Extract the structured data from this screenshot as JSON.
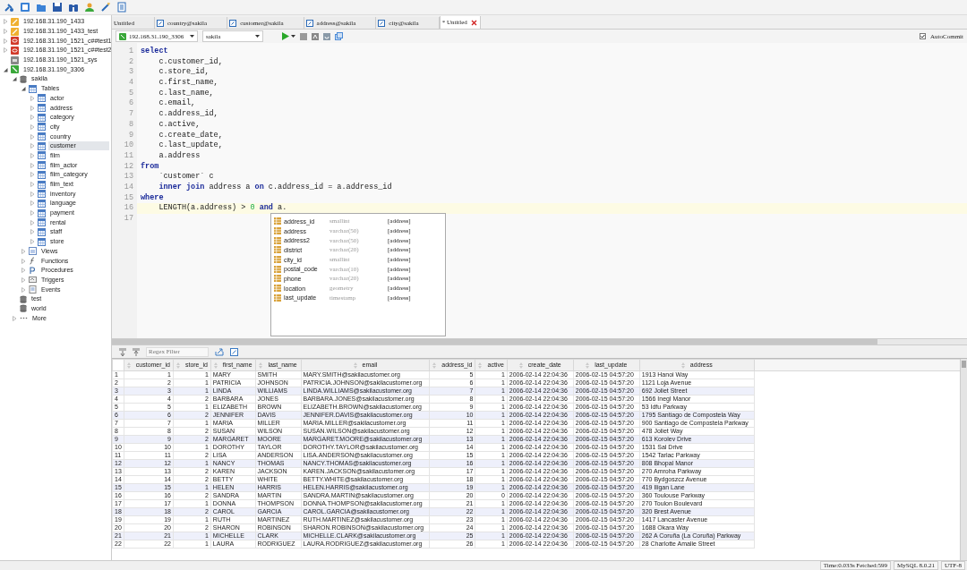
{
  "tree": [
    {
      "label": "192.168.31.190_1433",
      "kind": "mssql",
      "expanded": false,
      "selected": false
    },
    {
      "label": "192.168.31.190_1433_test",
      "kind": "mssql",
      "expanded": false,
      "selected": false
    },
    {
      "label": "192.168.31.190_1521_c##test1",
      "kind": "oracle",
      "expanded": false,
      "selected": false
    },
    {
      "label": "192.168.31.190_1521_c##test2",
      "kind": "oracle",
      "expanded": false,
      "selected": false
    },
    {
      "label": "192.168.31.190_1521_sys",
      "kind": "generic",
      "selected": false
    },
    {
      "label": "192.168.31.190_3306",
      "kind": "mysql",
      "expanded": true,
      "selected": false,
      "children": [
        {
          "label": "sakila",
          "kind": "database",
          "expanded": true,
          "selected": false,
          "children": [
            {
              "label": "Tables",
              "kind": "tables",
              "expanded": true,
              "selected": false,
              "children": [
                {
                  "label": "actor",
                  "kind": "table",
                  "expanded": false,
                  "selected": false
                },
                {
                  "label": "address",
                  "kind": "table",
                  "expanded": false,
                  "selected": false
                },
                {
                  "label": "category",
                  "kind": "table",
                  "expanded": false,
                  "selected": false
                },
                {
                  "label": "city",
                  "kind": "table",
                  "expanded": false,
                  "selected": false
                },
                {
                  "label": "country",
                  "kind": "table",
                  "expanded": false,
                  "selected": false
                },
                {
                  "label": "customer",
                  "kind": "table",
                  "expanded": false,
                  "selected": true
                },
                {
                  "label": "film",
                  "kind": "table",
                  "expanded": false,
                  "selected": false
                },
                {
                  "label": "film_actor",
                  "kind": "table",
                  "expanded": false,
                  "selected": false
                },
                {
                  "label": "film_category",
                  "kind": "table",
                  "expanded": false,
                  "selected": false
                },
                {
                  "label": "film_text",
                  "kind": "table",
                  "expanded": false,
                  "selected": false
                },
                {
                  "label": "inventory",
                  "kind": "table",
                  "expanded": false,
                  "selected": false
                },
                {
                  "label": "language",
                  "kind": "table",
                  "expanded": false,
                  "selected": false
                },
                {
                  "label": "payment",
                  "kind": "table",
                  "expanded": false,
                  "selected": false
                },
                {
                  "label": "rental",
                  "kind": "table",
                  "expanded": false,
                  "selected": false
                },
                {
                  "label": "staff",
                  "kind": "table",
                  "expanded": false,
                  "selected": false
                },
                {
                  "label": "store",
                  "kind": "table",
                  "expanded": false,
                  "selected": false
                }
              ]
            },
            {
              "label": "Views",
              "kind": "views",
              "expanded": false,
              "selected": false
            },
            {
              "label": "Functions",
              "kind": "functions",
              "expanded": false,
              "selected": false
            },
            {
              "label": "Procedures",
              "kind": "procedures",
              "expanded": false,
              "selected": false
            },
            {
              "label": "Triggers",
              "kind": "triggers",
              "expanded": false,
              "selected": false
            },
            {
              "label": "Events",
              "kind": "events",
              "expanded": false,
              "selected": false
            }
          ]
        },
        {
          "label": "test",
          "kind": "database",
          "selected": false
        },
        {
          "label": "world",
          "kind": "database",
          "selected": false
        },
        {
          "label": "More",
          "kind": "more",
          "expanded": false,
          "selected": false
        }
      ]
    }
  ],
  "tabs": [
    {
      "label": "Untitled",
      "kind": "query",
      "selected": false
    },
    {
      "label": "country@sakila",
      "kind": "table",
      "selected": false
    },
    {
      "label": "customer@sakila",
      "kind": "table",
      "selected": false
    },
    {
      "label": "address@sakila",
      "kind": "table",
      "selected": false
    },
    {
      "label": "city@sakila",
      "kind": "table",
      "selected": false
    },
    {
      "label": "* Untitled",
      "kind": "query",
      "selected": true
    }
  ],
  "query_toolbar": {
    "connection": "192.168.31.190_3306",
    "database": "sakila",
    "autocommit": {
      "label": "AutoCommit",
      "checked": true
    }
  },
  "editor": {
    "lines": [
      {
        "number": "1",
        "current": false,
        "segments": [
          {
            "kind": "keyword",
            "text": "select"
          }
        ]
      },
      {
        "number": "2",
        "current": false,
        "segments": [
          {
            "kind": "text",
            "text": "    c.customer_id,"
          }
        ]
      },
      {
        "number": "3",
        "current": false,
        "segments": [
          {
            "kind": "text",
            "text": "    c.store_id,"
          }
        ]
      },
      {
        "number": "4",
        "current": false,
        "segments": [
          {
            "kind": "text",
            "text": "    c.first_name,"
          }
        ]
      },
      {
        "number": "5",
        "current": false,
        "segments": [
          {
            "kind": "text",
            "text": "    c.last_name,"
          }
        ]
      },
      {
        "number": "6",
        "current": false,
        "segments": [
          {
            "kind": "text",
            "text": "    c.email,"
          }
        ]
      },
      {
        "number": "7",
        "current": false,
        "segments": [
          {
            "kind": "text",
            "text": "    c.address_id,"
          }
        ]
      },
      {
        "number": "8",
        "current": false,
        "segments": [
          {
            "kind": "text",
            "text": "    c.active,"
          }
        ]
      },
      {
        "number": "9",
        "current": false,
        "segments": [
          {
            "kind": "text",
            "text": "    c.create_date,"
          }
        ]
      },
      {
        "number": "10",
        "current": false,
        "segments": [
          {
            "kind": "text",
            "text": "    c.last_update,"
          }
        ]
      },
      {
        "number": "11",
        "current": false,
        "segments": [
          {
            "kind": "text",
            "text": "    a.address"
          }
        ]
      },
      {
        "number": "12",
        "current": false,
        "segments": [
          {
            "kind": "keyword",
            "text": "from"
          }
        ]
      },
      {
        "number": "13",
        "current": false,
        "segments": [
          {
            "kind": "text",
            "text": "    `customer` c"
          }
        ]
      },
      {
        "number": "14",
        "current": false,
        "segments": [
          {
            "kind": "keyword",
            "text": "    inner join"
          },
          {
            "kind": "text",
            "text": " address a "
          },
          {
            "kind": "keyword",
            "text": "on"
          },
          {
            "kind": "text",
            "text": " c.address_id = a.address_id"
          }
        ]
      },
      {
        "number": "15",
        "current": false,
        "segments": [
          {
            "kind": "keyword",
            "text": "where"
          }
        ]
      },
      {
        "number": "16",
        "current": true,
        "segments": [
          {
            "kind": "text",
            "text": "    LENGTH(a.address) > "
          },
          {
            "kind": "number",
            "text": "0"
          },
          {
            "kind": "keyword",
            "text": " and"
          },
          {
            "kind": "text",
            "text": " a."
          }
        ]
      },
      {
        "number": "17",
        "current": false
      }
    ]
  },
  "autocomplete": [
    {
      "name": "address_id",
      "type": "smallint",
      "table": "[address]"
    },
    {
      "name": "address",
      "type": "varchar(50)",
      "table": "[address]"
    },
    {
      "name": "address2",
      "type": "varchar(50)",
      "table": "[address]"
    },
    {
      "name": "district",
      "type": "varchar(20)",
      "table": "[address]"
    },
    {
      "name": "city_id",
      "type": "smallint",
      "table": "[address]"
    },
    {
      "name": "postal_code",
      "type": "varchar(10)",
      "table": "[address]"
    },
    {
      "name": "phone",
      "type": "varchar(20)",
      "table": "[address]"
    },
    {
      "name": "location",
      "type": "geometry",
      "table": "[address]"
    },
    {
      "name": "last_update",
      "type": "timestamp",
      "table": "[address]"
    }
  ],
  "results": {
    "filter": {
      "placeholder": "Regex Filter"
    },
    "columns": [
      {
        "label": "customer_id",
        "numeric": true
      },
      {
        "label": "store_id",
        "numeric": true
      },
      {
        "label": "first_name",
        "numeric": false
      },
      {
        "label": "last_name",
        "numeric": false
      },
      {
        "label": "email",
        "numeric": false
      },
      {
        "label": "address_id",
        "numeric": true
      },
      {
        "label": "active",
        "numeric": true
      },
      {
        "label": "create_date",
        "numeric": false
      },
      {
        "label": "last_update",
        "numeric": false
      },
      {
        "label": "address",
        "numeric": false
      }
    ],
    "rows": [
      {
        "number": "1",
        "cells": [
          "1",
          "1",
          "MARY",
          "SMITH",
          "MARY.SMITH@sakilacustomer.org",
          "5",
          "1",
          "2006-02-14 22:04:36",
          "2006-02-15 04:57:20",
          "1913 Hanoi Way"
        ]
      },
      {
        "number": "2",
        "cells": [
          "2",
          "1",
          "PATRICIA",
          "JOHNSON",
          "PATRICIA.JOHNSON@sakilacustomer.org",
          "6",
          "1",
          "2006-02-14 22:04:36",
          "2006-02-15 04:57:20",
          "1121 Loja Avenue"
        ]
      },
      {
        "number": "3",
        "cells": [
          "3",
          "1",
          "LINDA",
          "WILLIAMS",
          "LINDA.WILLIAMS@sakilacustomer.org",
          "7",
          "1",
          "2006-02-14 22:04:36",
          "2006-02-15 04:57:20",
          "692 Joliet Street"
        ]
      },
      {
        "number": "4",
        "cells": [
          "4",
          "2",
          "BARBARA",
          "JONES",
          "BARBARA.JONES@sakilacustomer.org",
          "8",
          "1",
          "2006-02-14 22:04:36",
          "2006-02-15 04:57:20",
          "1566 Inegl Manor"
        ]
      },
      {
        "number": "5",
        "cells": [
          "5",
          "1",
          "ELIZABETH",
          "BROWN",
          "ELIZABETH.BROWN@sakilacustomer.org",
          "9",
          "1",
          "2006-02-14 22:04:36",
          "2006-02-15 04:57:20",
          "53 Idfu Parkway"
        ]
      },
      {
        "number": "6",
        "cells": [
          "6",
          "2",
          "JENNIFER",
          "DAVIS",
          "JENNIFER.DAVIS@sakilacustomer.org",
          "10",
          "1",
          "2006-02-14 22:04:36",
          "2006-02-15 04:57:20",
          "1795 Santiago de Compostela Way"
        ]
      },
      {
        "number": "7",
        "cells": [
          "7",
          "1",
          "MARIA",
          "MILLER",
          "MARIA.MILLER@sakilacustomer.org",
          "11",
          "1",
          "2006-02-14 22:04:36",
          "2006-02-15 04:57:20",
          "900 Santiago de Compostela Parkway"
        ]
      },
      {
        "number": "8",
        "cells": [
          "8",
          "2",
          "SUSAN",
          "WILSON",
          "SUSAN.WILSON@sakilacustomer.org",
          "12",
          "1",
          "2006-02-14 22:04:36",
          "2006-02-15 04:57:20",
          "478 Joliet Way"
        ]
      },
      {
        "number": "9",
        "cells": [
          "9",
          "2",
          "MARGARET",
          "MOORE",
          "MARGARET.MOORE@sakilacustomer.org",
          "13",
          "1",
          "2006-02-14 22:04:36",
          "2006-02-15 04:57:20",
          "613 Korolev Drive"
        ]
      },
      {
        "number": "10",
        "cells": [
          "10",
          "1",
          "DOROTHY",
          "TAYLOR",
          "DOROTHY.TAYLOR@sakilacustomer.org",
          "14",
          "1",
          "2006-02-14 22:04:36",
          "2006-02-15 04:57:20",
          "1531 Sal Drive"
        ]
      },
      {
        "number": "11",
        "cells": [
          "11",
          "2",
          "LISA",
          "ANDERSON",
          "LISA.ANDERSON@sakilacustomer.org",
          "15",
          "1",
          "2006-02-14 22:04:36",
          "2006-02-15 04:57:20",
          "1542 Tarlac Parkway"
        ]
      },
      {
        "number": "12",
        "cells": [
          "12",
          "1",
          "NANCY",
          "THOMAS",
          "NANCY.THOMAS@sakilacustomer.org",
          "16",
          "1",
          "2006-02-14 22:04:36",
          "2006-02-15 04:57:20",
          "808 Bhopal Manor"
        ]
      },
      {
        "number": "13",
        "cells": [
          "13",
          "2",
          "KAREN",
          "JACKSON",
          "KAREN.JACKSON@sakilacustomer.org",
          "17",
          "1",
          "2006-02-14 22:04:36",
          "2006-02-15 04:57:20",
          "270 Amroha Parkway"
        ]
      },
      {
        "number": "14",
        "cells": [
          "14",
          "2",
          "BETTY",
          "WHITE",
          "BETTY.WHITE@sakilacustomer.org",
          "18",
          "1",
          "2006-02-14 22:04:36",
          "2006-02-15 04:57:20",
          "770 Bydgoszcz Avenue"
        ]
      },
      {
        "number": "15",
        "cells": [
          "15",
          "1",
          "HELEN",
          "HARRIS",
          "HELEN.HARRIS@sakilacustomer.org",
          "19",
          "1",
          "2006-02-14 22:04:36",
          "2006-02-15 04:57:20",
          "419 Iligan Lane"
        ]
      },
      {
        "number": "16",
        "cells": [
          "16",
          "2",
          "SANDRA",
          "MARTIN",
          "SANDRA.MARTIN@sakilacustomer.org",
          "20",
          "0",
          "2006-02-14 22:04:36",
          "2006-02-15 04:57:20",
          "360 Toulouse Parkway"
        ]
      },
      {
        "number": "17",
        "cells": [
          "17",
          "1",
          "DONNA",
          "THOMPSON",
          "DONNA.THOMPSON@sakilacustomer.org",
          "21",
          "1",
          "2006-02-14 22:04:36",
          "2006-02-15 04:57:20",
          "270 Toulon Boulevard"
        ]
      },
      {
        "number": "18",
        "cells": [
          "18",
          "2",
          "CAROL",
          "GARCIA",
          "CAROL.GARCIA@sakilacustomer.org",
          "22",
          "1",
          "2006-02-14 22:04:36",
          "2006-02-15 04:57:20",
          "320 Brest Avenue"
        ]
      },
      {
        "number": "19",
        "cells": [
          "19",
          "1",
          "RUTH",
          "MARTINEZ",
          "RUTH.MARTINEZ@sakilacustomer.org",
          "23",
          "1",
          "2006-02-14 22:04:36",
          "2006-02-15 04:57:20",
          "1417 Lancaster Avenue"
        ]
      },
      {
        "number": "20",
        "cells": [
          "20",
          "2",
          "SHARON",
          "ROBINSON",
          "SHARON.ROBINSON@sakilacustomer.org",
          "24",
          "1",
          "2006-02-14 22:04:36",
          "2006-02-15 04:57:20",
          "1688 Okara Way"
        ]
      },
      {
        "number": "21",
        "cells": [
          "21",
          "1",
          "MICHELLE",
          "CLARK",
          "MICHELLE.CLARK@sakilacustomer.org",
          "25",
          "1",
          "2006-02-14 22:04:36",
          "2006-02-15 04:57:20",
          "262 A Coruña (La Coruña) Parkway"
        ]
      },
      {
        "number": "22",
        "cells": [
          "22",
          "1",
          "LAURA",
          "RODRIGUEZ",
          "LAURA.RODRIGUEZ@sakilacustomer.org",
          "26",
          "1",
          "2006-02-14 22:04:36",
          "2006-02-15 04:57:20",
          "28 Charlotte Amalie Street"
        ]
      }
    ]
  },
  "status_bar": [
    "Time:0.033s Fetched:599",
    "MySQL 8.0.21",
    "UTF-8"
  ]
}
